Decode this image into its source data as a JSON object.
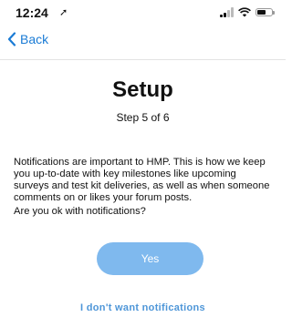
{
  "status_bar": {
    "time": "12:24",
    "location_arrow": "➚",
    "icons": [
      "signal-icon",
      "wifi-icon",
      "battery-icon"
    ],
    "battery_level": 0.6
  },
  "nav": {
    "back_label": "Back",
    "back_icon": "chevron-left-icon"
  },
  "main": {
    "title": "Setup",
    "step": "Step 5 of 6",
    "description": "Notifications are important to HMP. This is how we keep you up-to-date with key milestones like upcoming surveys and test kit deliveries, as well as when someone comments on or likes your forum posts.",
    "question": "Are you ok with notifications?",
    "yes_label": "Yes",
    "decline_label": "I don't want notifications"
  },
  "colors": {
    "accent": "#1a7bd5",
    "yes_button": "#7fb9ee",
    "decline_link": "#4e96d8"
  }
}
